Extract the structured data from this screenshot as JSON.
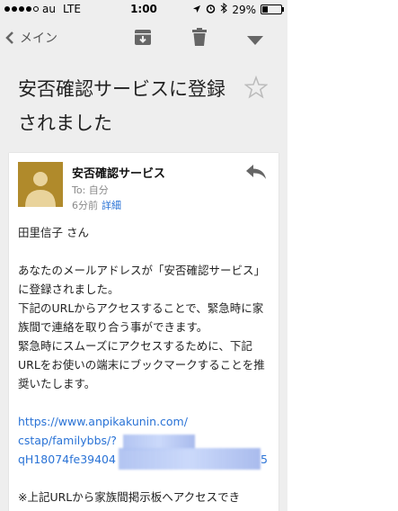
{
  "status": {
    "carrier": "au",
    "network": "LTE",
    "time": "1:00",
    "battery": "29%",
    "battery_level": 0.29
  },
  "toolbar": {
    "back_label": "メイン"
  },
  "email": {
    "subject": "安否確認サービスに登録されました",
    "sender": "安否確認サービス",
    "to": "To: 自分",
    "time": "6分前",
    "detail_link": "詳細",
    "body": {
      "greeting": "田里信子 さん",
      "p1": "あなたのメールアドレスが「安否確認サービス」に登録されました。",
      "p2": "下記のURLからアクセスすることで、緊急時に家族間で連絡を取り合う事ができます。",
      "p3": "緊急時にスムーズにアクセスするために、下記URLをお使いの端末にブックマークすることを推奨いたします。",
      "link_line1": "https://www.anpikakunin.com/",
      "link_line2": "cstap/familybbs/?",
      "link_line3": "qH18074fe39404",
      "link_tail": "5",
      "note": "※上記URLから家族間掲示板へアクセスでき"
    }
  },
  "colors": {
    "accent_link": "#2a73d6",
    "avatar_bg": "#b08a2b",
    "background": "#eeeeee"
  }
}
